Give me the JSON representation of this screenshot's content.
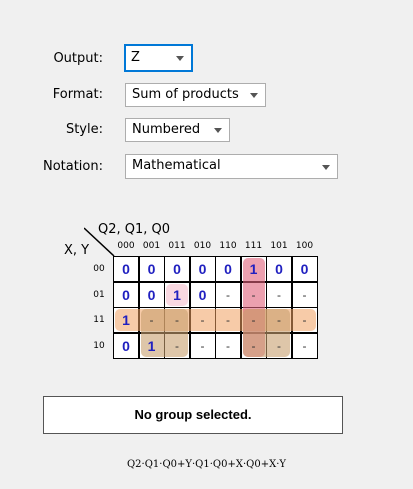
{
  "settings": {
    "output": {
      "label": "Output:",
      "value": "Z"
    },
    "format": {
      "label": "Format:",
      "value": "Sum of products"
    },
    "style": {
      "label": "Style:",
      "value": "Numbered"
    },
    "notation": {
      "label": "Notation:",
      "value": "Mathematical"
    }
  },
  "kmap": {
    "col_vars": "Q2, Q1, Q0",
    "row_vars": "X, Y",
    "col_labels": [
      "000",
      "001",
      "011",
      "010",
      "110",
      "111",
      "101",
      "100"
    ],
    "row_labels": [
      "00",
      "01",
      "11",
      "10"
    ],
    "cells": [
      [
        "0",
        "0",
        "0",
        "0",
        "0",
        "1",
        "0",
        "0"
      ],
      [
        "0",
        "0",
        "1",
        "0",
        "-",
        "-",
        "-",
        "-"
      ],
      [
        "1",
        "-",
        "-",
        "-",
        "-",
        "-",
        "-",
        "-"
      ],
      [
        "0",
        "1",
        "-",
        "-",
        "-",
        "-",
        "-",
        "-"
      ]
    ],
    "group_colors": {
      "pink": "#e0607a",
      "light_pink": "#f4b8c8",
      "orange": "#f0a060",
      "tan": "#c8a070"
    }
  },
  "status": {
    "message": "No group selected."
  },
  "expression": "Q2·Q1·Q0+Y·Q1·Q0+X·Q0+X·Y"
}
